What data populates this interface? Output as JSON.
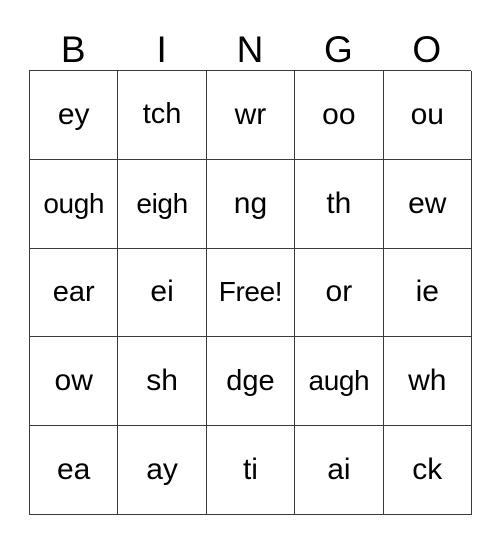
{
  "card": {
    "title": "BINGO",
    "header_letters": [
      "B",
      "I",
      "N",
      "G",
      "O"
    ],
    "free_space_label": "Free!",
    "colors": {
      "border": "#3a3a3a",
      "cell_background": "#ffffff",
      "text": "#000000",
      "page_background": "#ffffff"
    },
    "grid": {
      "columns": 5,
      "rows": 5,
      "cells": [
        [
          "ey",
          "tch",
          "wr",
          "oo",
          "ou"
        ],
        [
          "ough",
          "eigh",
          "ng",
          "th",
          "ew"
        ],
        [
          "ear",
          "ei",
          "Free!",
          "or",
          "ie"
        ],
        [
          "ow",
          "sh",
          "dge",
          "augh",
          "wh"
        ],
        [
          "ea",
          "ay",
          "ti",
          "ai",
          "ck"
        ]
      ]
    }
  }
}
